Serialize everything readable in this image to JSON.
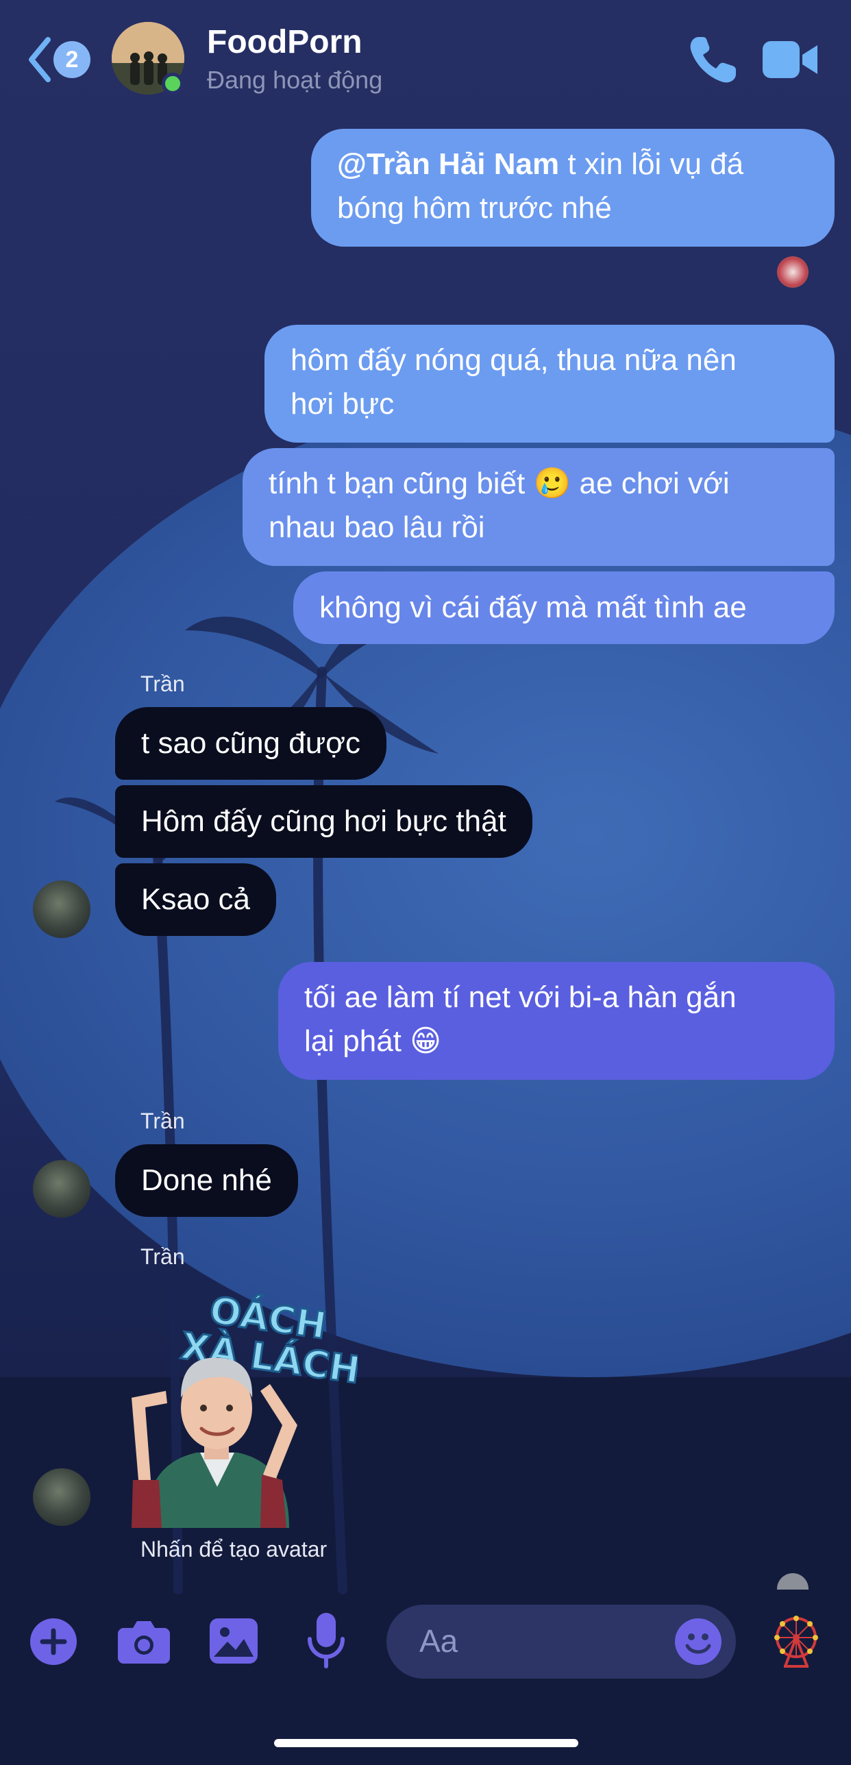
{
  "header": {
    "back_badge": "2",
    "title": "FoodPorn",
    "status": "Đang hoạt động",
    "online_color": "#5ad35a",
    "icons": [
      "back-chevron-icon",
      "phone-icon",
      "video-camera-icon"
    ]
  },
  "messages": [
    {
      "direction": "outgoing",
      "mention": "@Trần Hải Nam",
      "line1_rest": " t xin lỗi vụ đá",
      "line2": "bóng hôm trước nhé"
    },
    {
      "direction": "outgoing",
      "line1": "hôm đấy nóng quá, thua nữa nên",
      "line2": "hơi bực"
    },
    {
      "direction": "outgoing",
      "line1_before": "tính t bạn cũng biết ",
      "emoji": "🥲",
      "line1_after": " ae chơi với",
      "line2": "nhau bao lâu rồi"
    },
    {
      "direction": "outgoing",
      "text": "không vì cái đấy mà mất tình ae"
    },
    {
      "direction": "incoming",
      "sender": "Trần",
      "text": "t sao cũng được"
    },
    {
      "direction": "incoming",
      "text": "Hôm đấy cũng hơi bực thật"
    },
    {
      "direction": "incoming",
      "text": "Ksao cả"
    },
    {
      "direction": "outgoing",
      "line1": "tối ae làm tí net với bi-a hàn gắn",
      "line2_before": "lại phát ",
      "emoji": "😁"
    },
    {
      "direction": "incoming",
      "sender": "Trần",
      "text": "Done nhé"
    },
    {
      "direction": "incoming",
      "sender": "Trần",
      "type": "sticker",
      "sticker_text_1": "OÁCH",
      "sticker_text_2": "XÀ LÁCH",
      "caption": "Nhấn để tạo avatar"
    }
  ],
  "composer": {
    "placeholder": "Aa",
    "icons": [
      "plus-icon",
      "camera-icon",
      "gallery-icon",
      "microphone-icon",
      "emoji-icon",
      "theme-ferris-wheel-icon"
    ]
  },
  "colors": {
    "outgoing_bubble_top": "#6c9cf0",
    "outgoing_bubble_bottom": "#5b5fe0",
    "incoming_bubble": "#0a0d1e",
    "accent": "#6e63e6",
    "icon_blue": "#6fb2f5"
  }
}
